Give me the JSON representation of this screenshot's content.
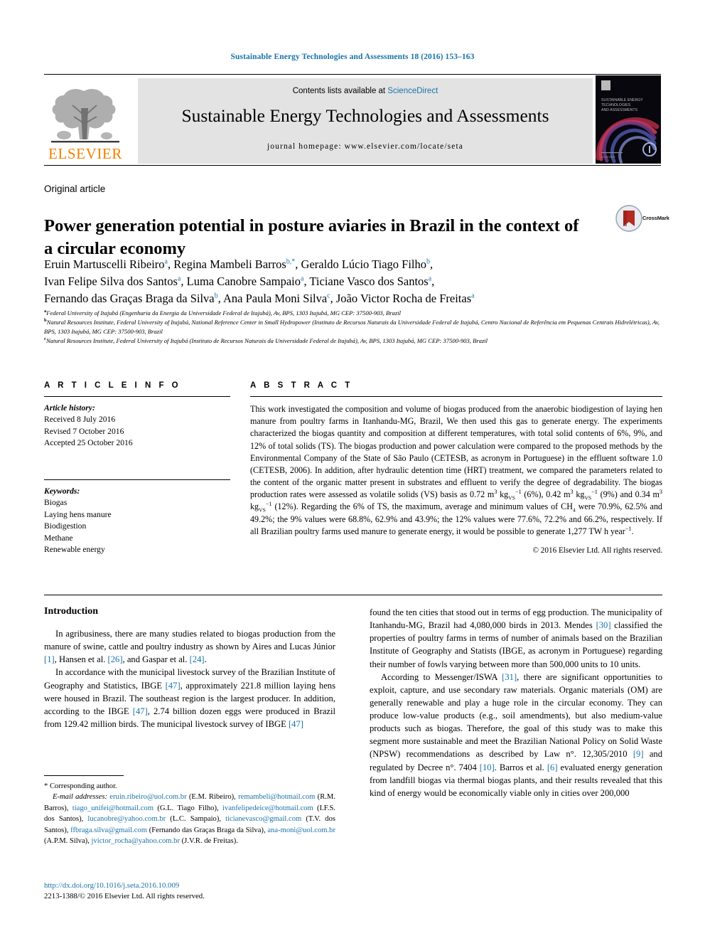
{
  "running_head": "Sustainable Energy Technologies and Assessments 18 (2016) 153–163",
  "masthead": {
    "contents_prefix": "Contents lists available at ",
    "sciencedirect": "ScienceDirect",
    "journal_name": "Sustainable Energy Technologies and Assessments",
    "homepage": "journal homepage: www.elsevier.com/locate/seta",
    "publisher": "ELSEVIER",
    "cover_title_line1": "SUSTAINABLE ENERGY",
    "cover_title_line2": "TECHNOLOGIES",
    "cover_title_line3": "AND ASSESSMENTS",
    "accent_blue": "#1a72a8",
    "elsevier_orange": "#f08000",
    "band_grey": "#e3e3e3"
  },
  "article": {
    "type": "Original article",
    "title": "Power generation potential in posture aviaries in Brazil in the context of a circular economy",
    "crossmark_label": "CrossMark"
  },
  "authors": {
    "line1": [
      {
        "name": "Eruin Martuscelli Ribeiro",
        "sup": "a",
        "sep": ", "
      },
      {
        "name": "Regina Mambeli Barros",
        "sup": "b,*",
        "sep": ", "
      },
      {
        "name": "Geraldo Lúcio Tiago Filho",
        "sup": "b",
        "sep": ","
      }
    ],
    "line2": [
      {
        "name": "Ivan Felipe Silva dos Santos",
        "sup": "a",
        "sep": ", "
      },
      {
        "name": "Luma Canobre Sampaio",
        "sup": "a",
        "sep": ", "
      },
      {
        "name": "Ticiane Vasco dos Santos",
        "sup": "a",
        "sep": ","
      }
    ],
    "line3": [
      {
        "name": "Fernando das Graças Braga da Silva",
        "sup": "b",
        "sep": ", "
      },
      {
        "name": "Ana Paula Moni Silva",
        "sup": "c",
        "sep": ", "
      },
      {
        "name": "João Victor Rocha de Freitas",
        "sup": "a",
        "sep": ""
      }
    ]
  },
  "affiliations": [
    {
      "mark": "a",
      "text": "Federal University of Itajubá (Engenharia da Energia da Universidade Federal de Itajubá), Av, BPS, 1303 Itajubá, MG CEP: 37500-903, Brazil"
    },
    {
      "mark": "b",
      "text": "Natural Resources Institute, Federal University of Itajubá, National Reference Center in Small Hydropower (Instituto de Recursos Naturais da Universidade Federal de Itajubá, Centro Nacional de Referência em Pequenas Centrais Hidrelétricas), Av, BPS, 1303 Itajubá, MG CEP: 37500-903, Brazil"
    },
    {
      "mark": "c",
      "text": "Natural Resources Institute, Federal University of Itajubá (Instituto de Recursos Naturais da Universidade Federal de Itajubá), Av, BPS, 1303 Itajubá, MG CEP: 37500-903, Brazil"
    }
  ],
  "article_info": {
    "heading": "A R T I C L E   I N F O",
    "history_label": "Article history:",
    "history": [
      "Received 8 July 2016",
      "Revised 7 October 2016",
      "Accepted 25 October 2016"
    ],
    "keywords_label": "Keywords:",
    "keywords": [
      "Biogas",
      "Laying hens manure",
      "Biodigestion",
      "Methane",
      "Renewable energy"
    ]
  },
  "abstract": {
    "heading": "A B S T R A C T",
    "p1": "This work investigated the composition and volume of biogas produced from the anaerobic biodigestion of laying hen manure from poultry farms in Itanhandu-MG, Brazil, We then used this gas to generate energy. The experiments characterized the biogas quantity and composition at different temperatures, with total solid contents of 6%, 9%, and 12% of total solids (TS). The biogas production and power calculation were compared to the proposed methods by the Environmental Company of the State of São Paulo (CETESB, as acronym in Portuguese) in the effluent software 1.0 (CETESB, 2006). In addition, after hydraulic detention time (HRT) treatment, we compared the parameters related to the content of the organic matter present in substrates and effluent to verify the degree of degradability. The biogas production rates were assessed as volatile solids (VS) basis as 0.72 m",
    "p1_b": " (6%), 0.42 m",
    "p1_c": " (9%) and 0.34 m",
    "p1_d": " (12%). Regarding the 6% of TS, the maximum, average and minimum values of CH",
    "p1_e": " were 70.9%, 62.5% and 49.2%; the 9% values were 68.8%, 62.9% and 43.9%; the 12% values were 77.6%, 72.2% and 66.2%, respectively. If all Brazilian poultry farms used manure to generate energy, it would be possible to generate 1,277 TW h year",
    "p1_f": ".",
    "unit_cube": "3",
    "unit_kg": "kg",
    "unit_vs": "VS",
    "unit_neg1": "−1",
    "ch4_sub": "4",
    "year_exp": "−1",
    "copyright": "© 2016 Elsevier Ltd. All rights reserved."
  },
  "introduction": {
    "heading": "Introduction",
    "left_paragraphs": [
      [
        {
          "t": "In agribusiness, there are many studies related to biogas production from the manure of swine, cattle and poultry industry as shown by Aires and Lucas Júnior "
        },
        {
          "t": "[1]",
          "ref": true
        },
        {
          "t": ", Hansen et al. "
        },
        {
          "t": "[26]",
          "ref": true
        },
        {
          "t": ", and Gaspar et al. "
        },
        {
          "t": "[24]",
          "ref": true
        },
        {
          "t": "."
        }
      ],
      [
        {
          "t": "In accordance with the municipal livestock survey of the Brazilian Institute of Geography and Statistics, IBGE "
        },
        {
          "t": "[47]",
          "ref": true
        },
        {
          "t": ", approximately 221.8 million laying hens were housed in Brazil. The southeast region is the largest producer. In addition, according to the IBGE "
        },
        {
          "t": "[47]",
          "ref": true
        },
        {
          "t": ", 2.74 billion dozen eggs were produced in Brazil from 129.42 million birds. The municipal livestock survey of IBGE "
        },
        {
          "t": "[47]",
          "ref": true
        }
      ]
    ],
    "right_paragraphs": [
      [
        {
          "t": "found the ten cities that stood out in terms of egg production. The municipality of Itanhandu-MG, Brazil had 4,080,000 birds in 2013. Mendes "
        },
        {
          "t": "[30]",
          "ref": true
        },
        {
          "t": " classified the properties of poultry farms in terms of number of animals based on the Brazilian Institute of Geography and Statists (IBGE, as acronym in Portuguese) regarding their number of fowls varying between more than 500,000 units to 10 units."
        }
      ],
      [
        {
          "t": "According to Messenger/ISWA "
        },
        {
          "t": "[31]",
          "ref": true
        },
        {
          "t": ", there are significant opportunities to exploit, capture, and use secondary raw materials. Organic materials (OM) are generally renewable and play a huge role in the circular economy. They can produce low-value products (e.g., soil amendments), but also medium-value products such as biogas. Therefore, the goal of this study was to make this segment more sustainable and meet the Brazilian National Policy on Solid Waste (NPSW) recommendations as described by Law n°. 12,305/2010 "
        },
        {
          "t": "[9]",
          "ref": true
        },
        {
          "t": " and regulated by Decree n°. 7404 "
        },
        {
          "t": "[10]",
          "ref": true
        },
        {
          "t": ". Barros et al. "
        },
        {
          "t": "[6]",
          "ref": true
        },
        {
          "t": " evaluated energy generation from landfill biogas via thermal biogas plants, and their results revealed that this kind of energy would be economically viable only in cities over 200,000"
        }
      ]
    ]
  },
  "footnote": {
    "star": "*",
    "corresponding": "Corresponding author.",
    "email_label": "E-mail addresses:",
    "emails": [
      {
        "addr": "eruin.ribeiro@uol.com.br",
        "who": " (E.M. Ribeiro), "
      },
      {
        "addr": "remambeli@hotmail.com",
        "who": " (R.M. Barros), "
      },
      {
        "addr": "tiago_unifei@hotmail.com",
        "who": " (G.L. Tiago Filho), "
      },
      {
        "addr": "ivanfelipedeice@hotmail.com",
        "who": " (I.F.S. dos Santos), "
      },
      {
        "addr": "lucanobre@yahoo.com.br",
        "who": " (L.C. Sampaio), "
      },
      {
        "addr": "ticianevasco@gmail.com",
        "who": " (T.V. dos Santos), "
      },
      {
        "addr": "ffbraga.silva@gmail.com",
        "who": " (Fernando das Graças Braga da Silva), "
      },
      {
        "addr": "ana-moni@uol.com.br",
        "who": " (A.P.M. Silva), "
      },
      {
        "addr": "jvictor_rocha@yahoo.com.br",
        "who": " (J.V.R. de Freitas)."
      }
    ]
  },
  "doi_block": {
    "doi": "http://dx.doi.org/10.1016/j.seta.2016.10.009",
    "issn_line": "2213-1388/© 2016 Elsevier Ltd. All rights reserved."
  }
}
